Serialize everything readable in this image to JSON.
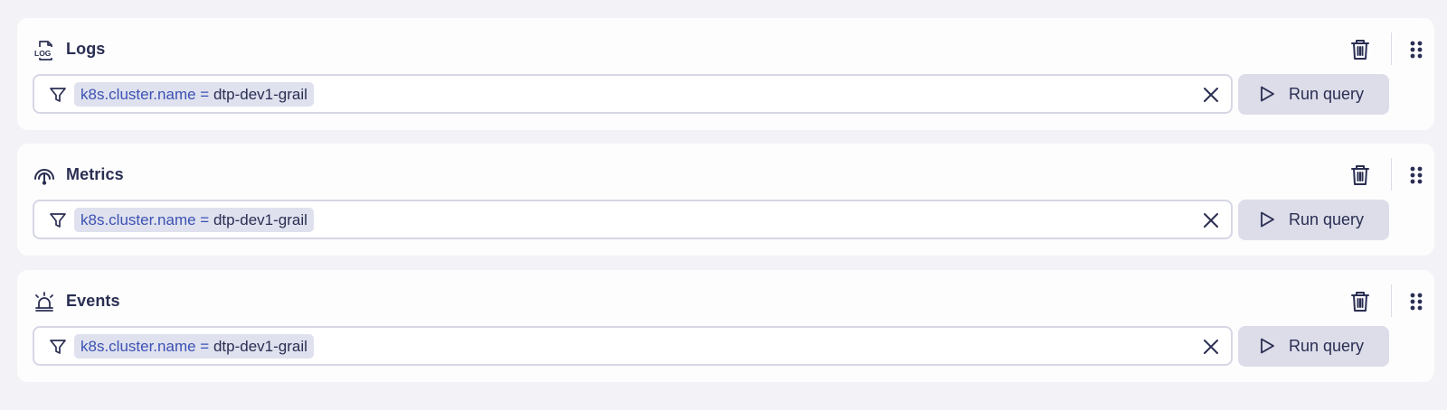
{
  "sections": [
    {
      "title": "Logs",
      "icon": "log-file-icon",
      "filter": {
        "key": "k8s.cluster.name",
        "operator": "=",
        "value": "dtp-dev1-grail"
      },
      "run_label": "Run query"
    },
    {
      "title": "Metrics",
      "icon": "gauge-icon",
      "filter": {
        "key": "k8s.cluster.name",
        "operator": "=",
        "value": "dtp-dev1-grail"
      },
      "run_label": "Run query"
    },
    {
      "title": "Events",
      "icon": "siren-icon",
      "filter": {
        "key": "k8s.cluster.name",
        "operator": "=",
        "value": "dtp-dev1-grail"
      },
      "run_label": "Run query"
    }
  ],
  "icons": {
    "delete": "trash-icon",
    "drag": "drag-handle-icon",
    "filter": "filter-icon",
    "clear": "close-icon",
    "run": "play-icon"
  },
  "colors": {
    "background": "#f3f3f7",
    "card": "#fdfdfe",
    "text": "#2a2e52",
    "chip_background": "#dfe1ee",
    "chip_key": "#3c52b4",
    "button_background": "#dcdde9",
    "input_border": "#d6d7e4"
  }
}
